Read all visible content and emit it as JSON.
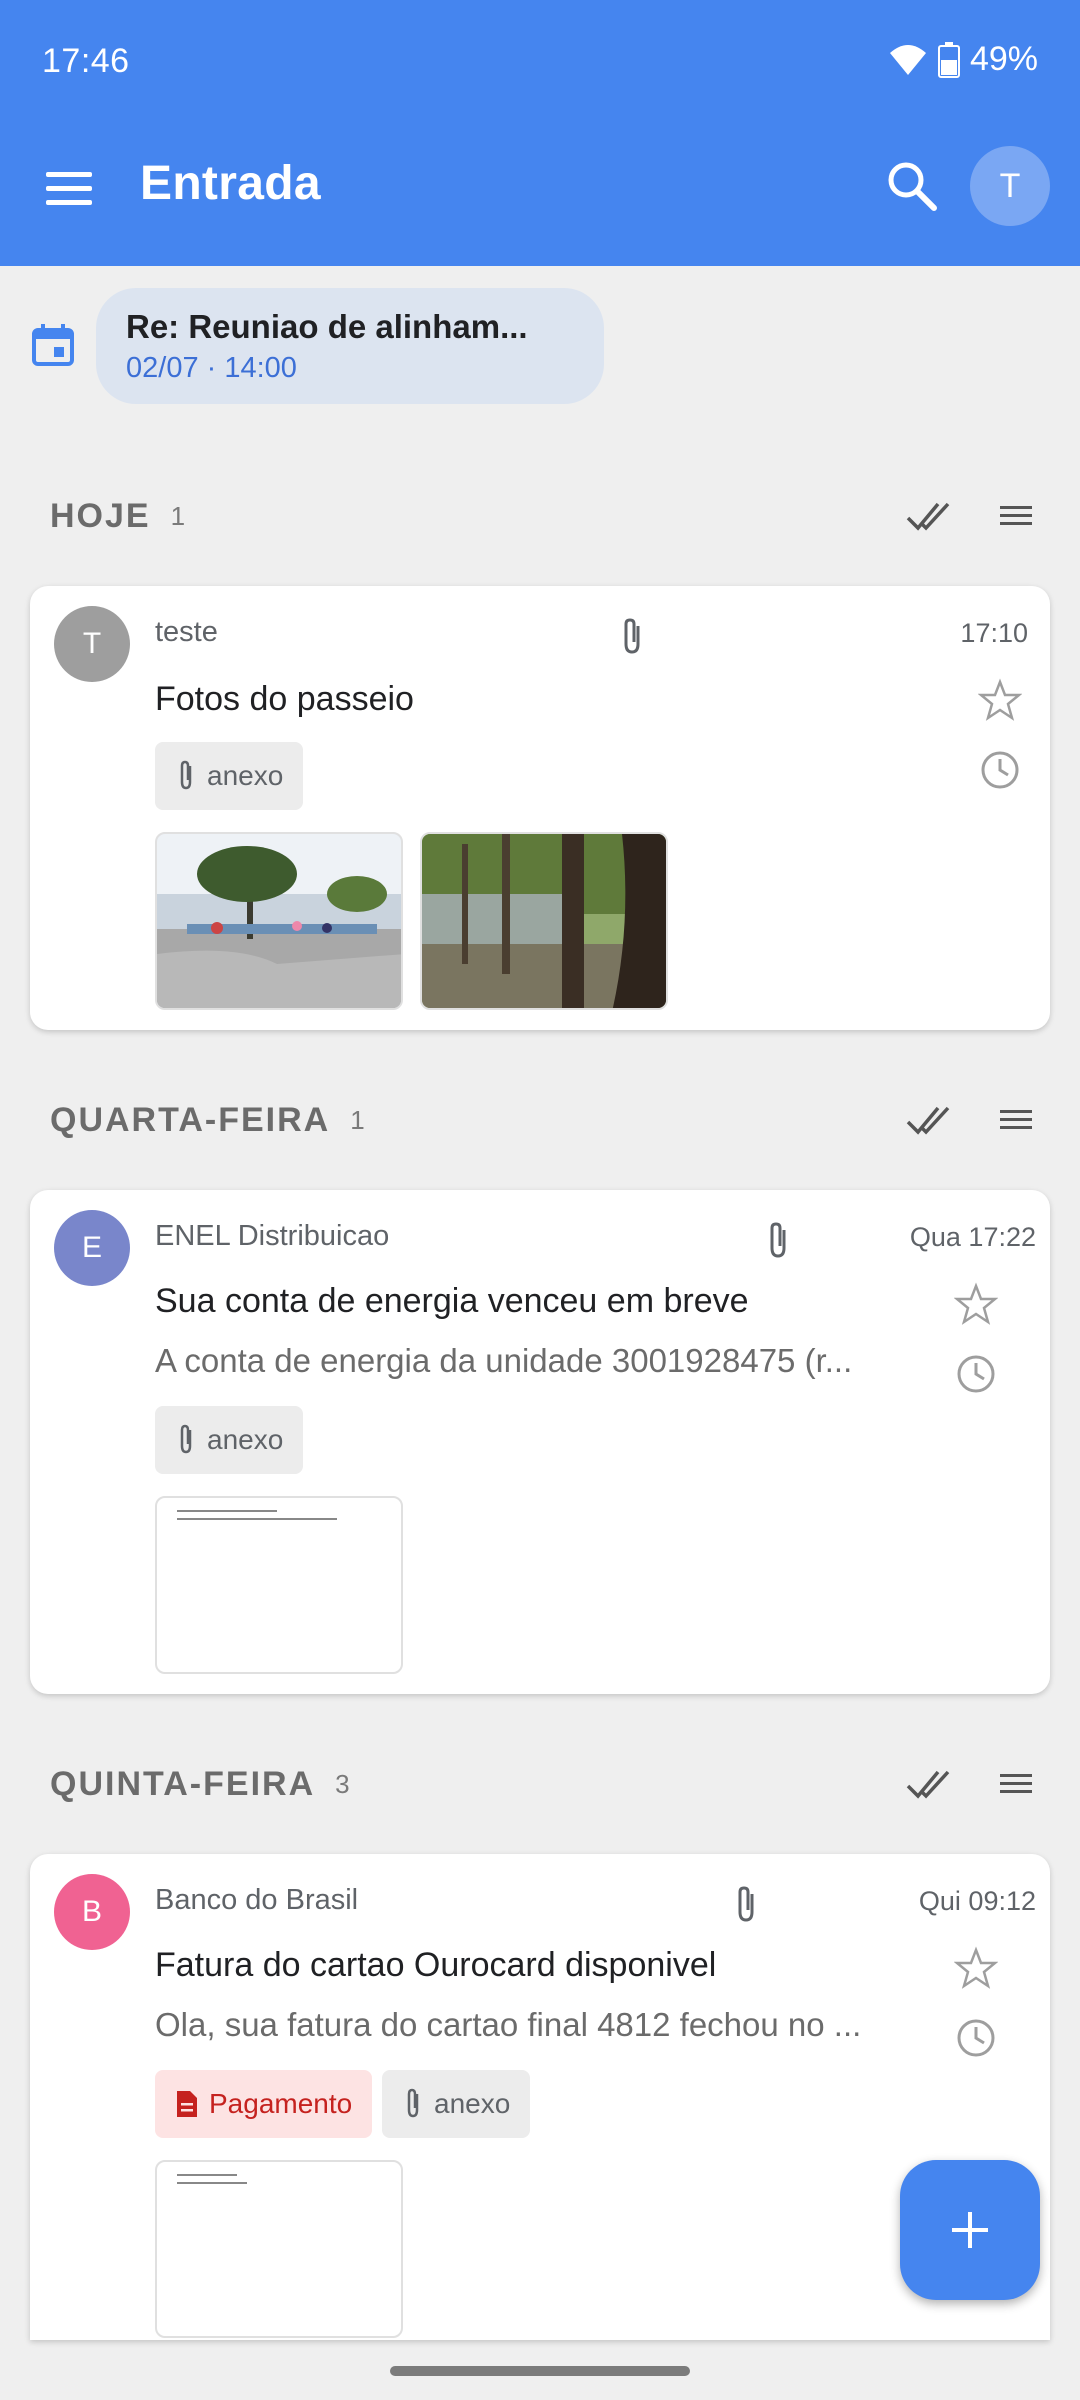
{
  "status_bar": {
    "time": "17:46",
    "battery": "49%"
  },
  "app_bar": {
    "title": "Entrada",
    "avatar_letter": "T"
  },
  "event": {
    "title": "Re: Reuniao de alinham...",
    "subtitle": "02/07 · 14:00"
  },
  "sections": [
    {
      "title": "HOJE",
      "count": "1"
    },
    {
      "title": "QUARTA-FEIRA",
      "count": "1"
    },
    {
      "title": "QUINTA-FEIRA",
      "count": "3"
    }
  ],
  "emails": [
    {
      "avatar": "T",
      "avatar_color": "#9e9e9e",
      "sender": "teste",
      "time": "17:10",
      "subject": "Fotos do passeio",
      "tags": [
        "anexo"
      ]
    },
    {
      "avatar": "E",
      "avatar_color": "#7986cb",
      "sender": "ENEL Distribuicao",
      "time": "Qua 17:22",
      "subject": "Sua conta de energia venceu em breve",
      "preview": "A conta de energia da unidade 3001928475 (r...",
      "tags": [
        "anexo"
      ]
    },
    {
      "avatar": "B",
      "avatar_color": "#f06292",
      "sender": "Banco do Brasil",
      "time": "Qui 09:12",
      "subject": "Fatura do cartao Ourocard disponivel",
      "preview": "Ola, sua fatura do cartao final 4812 fechou no ...",
      "tags": [
        "Pagamento",
        "anexo"
      ]
    }
  ],
  "colors": {
    "primary": "#4585ef",
    "background": "#efefef",
    "tag_red": "#c5221f"
  }
}
